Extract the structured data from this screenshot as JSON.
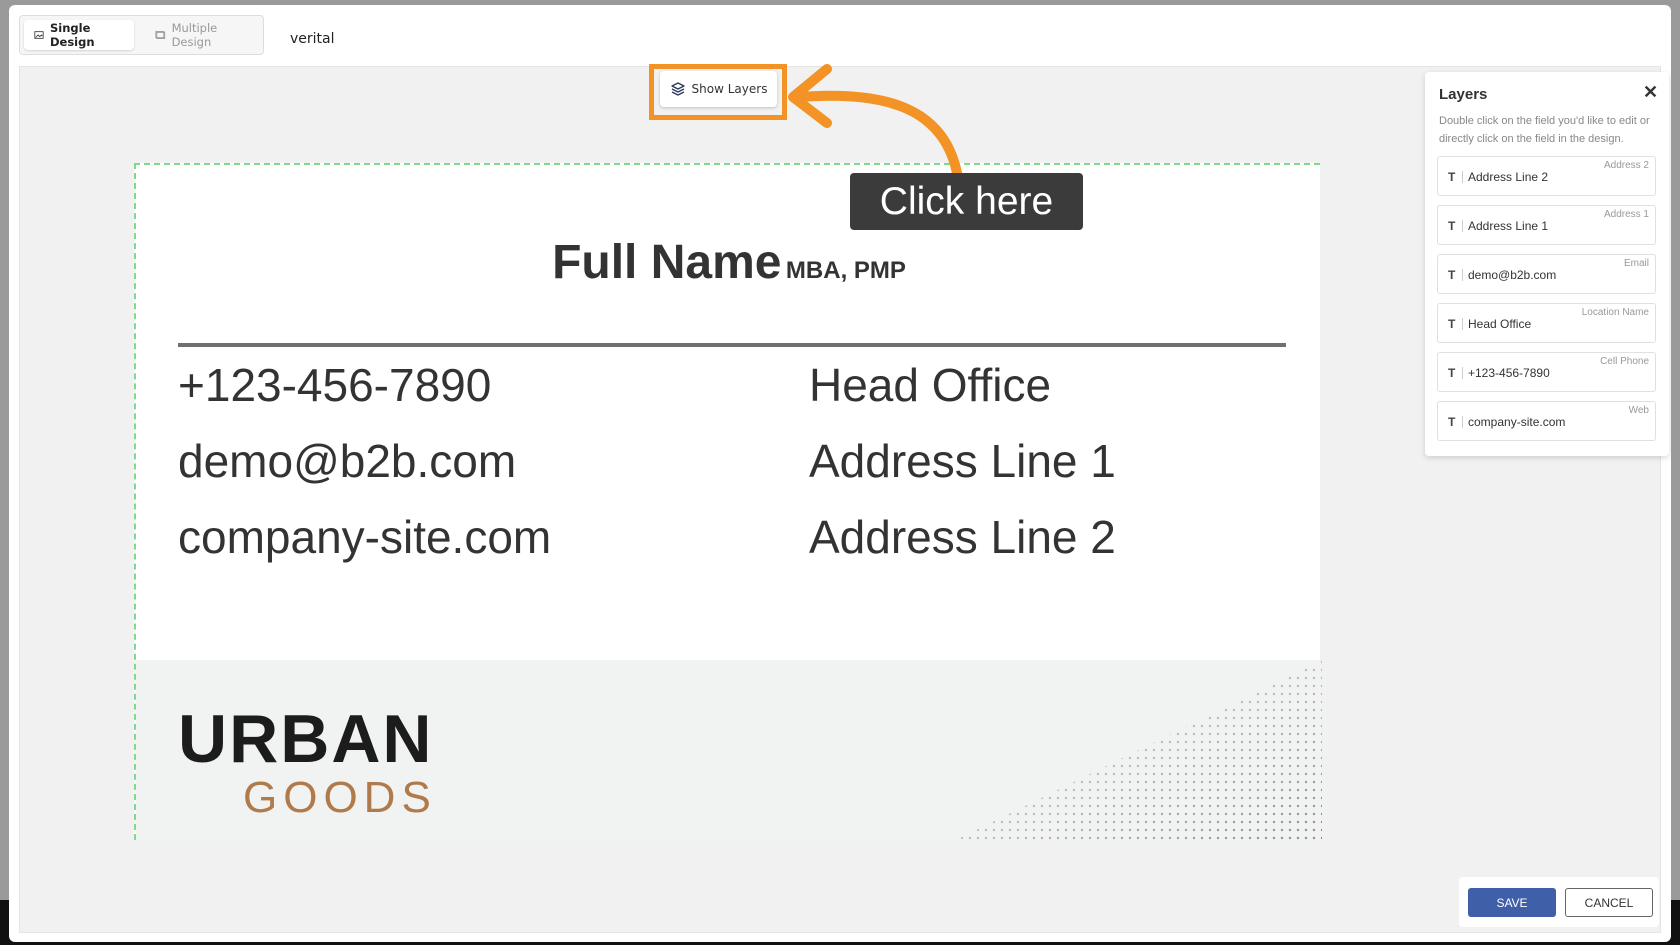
{
  "tabs": {
    "single": "Single Design",
    "multiple": "Multiple Design"
  },
  "design_title": "verital",
  "show_layers_label": "Show Layers",
  "callout_text": "Click here",
  "card": {
    "full_name": "Full Name",
    "credentials": "MBA, PMP",
    "phone": "+123-456-7890",
    "email": "demo@b2b.com",
    "website": "company-site.com",
    "location": "Head Office",
    "address1": "Address Line 1",
    "address2": "Address Line 2",
    "logo_line1": "URBAN",
    "logo_line2": "GOODS"
  },
  "layers": {
    "title": "Layers",
    "help": "Double click on the field you'd like to edit or directly click on the field in the design.",
    "items": [
      {
        "value": "Address Line 2",
        "tag": "Address 2"
      },
      {
        "value": "Address Line 1",
        "tag": "Address 1"
      },
      {
        "value": "demo@b2b.com",
        "tag": "Email"
      },
      {
        "value": "Head Office",
        "tag": "Location Name"
      },
      {
        "value": "+123-456-7890",
        "tag": "Cell Phone"
      },
      {
        "value": "company-site.com",
        "tag": "Web"
      }
    ]
  },
  "actions": {
    "save": "SAVE",
    "cancel": "CANCEL"
  },
  "colors": {
    "highlight": "#f39325",
    "save_button": "#3f5fa8",
    "logo_accent": "#b07a4b"
  }
}
